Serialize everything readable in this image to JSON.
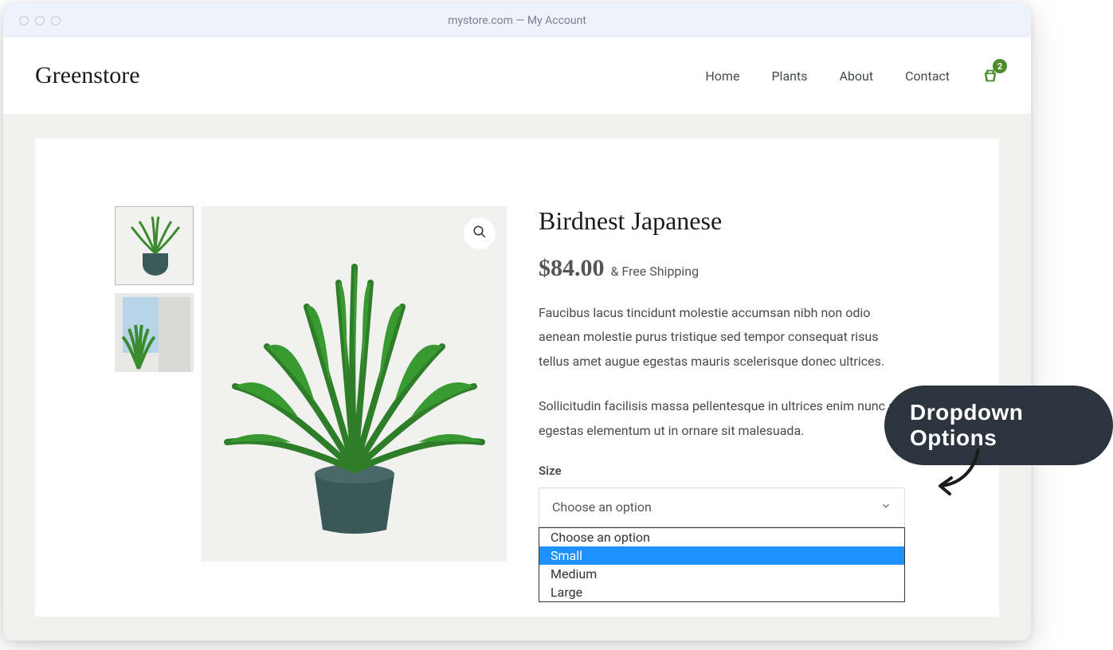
{
  "browser": {
    "title": "mystore.com — My Account"
  },
  "header": {
    "logo": "Greenstore",
    "nav": {
      "home": "Home",
      "plants": "Plants",
      "about": "About",
      "contact": "Contact"
    },
    "cart_count": "2"
  },
  "product": {
    "title": "Birdnest Japanese",
    "price": "$84.00",
    "shipping": "& Free Shipping",
    "description_1": "Faucibus lacus tincidunt molestie accumsan nibh non odio aenean molestie purus tristique sed tempor consequat risus tellus amet augue egestas mauris scelerisque donec ultrices.",
    "description_2": "Sollicitudin facilisis massa pellentesque in ultrices enim nunc ac egestas elementum ut in ornare sit malesuada.",
    "size_label": "Size",
    "select_placeholder": "Choose an option",
    "options": {
      "opt0": "Choose an option",
      "opt1": "Small",
      "opt2": "Medium",
      "opt3": "Large"
    }
  },
  "callout": {
    "label": "Dropdown Options"
  }
}
